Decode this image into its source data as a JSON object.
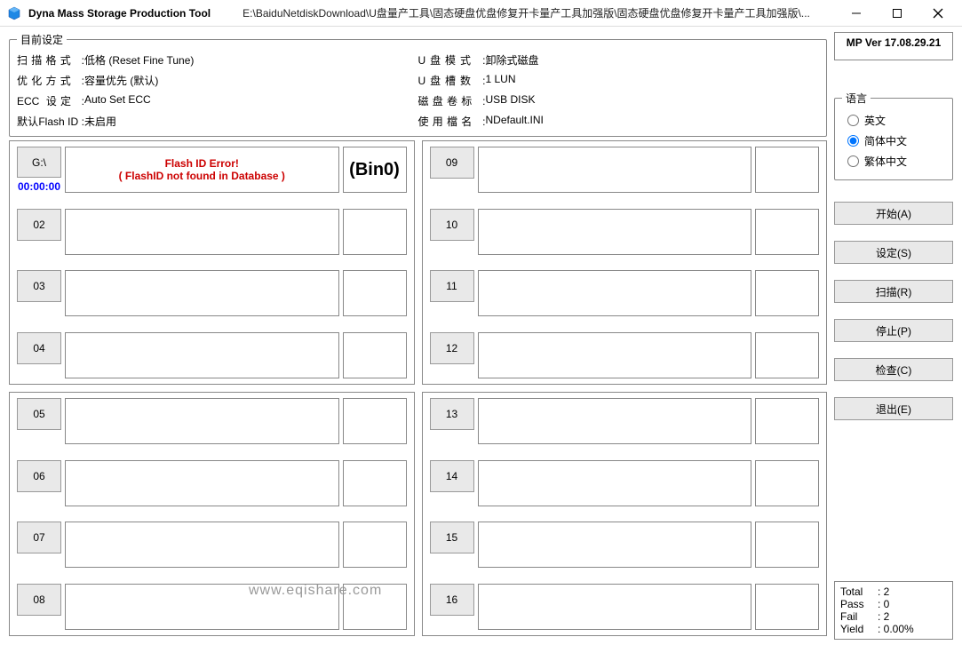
{
  "titlebar": {
    "app_title": "Dyna Mass Storage Production Tool",
    "path": "E:\\BaiduNetdiskDownload\\U盘量产工具\\固态硬盘优盘修复开卡量产工具加强版\\固态硬盘优盘修复开卡量产工具加强版\\..."
  },
  "settings": {
    "legend": "目前设定",
    "left": [
      {
        "label": "扫描格式",
        "value": "低格 (Reset Fine Tune)"
      },
      {
        "label": "优化方式",
        "value": "容量优先 (默认)"
      },
      {
        "label": "ECC 设定",
        "value": "Auto Set ECC"
      },
      {
        "label": "默认Flash ID",
        "value": "未启用"
      }
    ],
    "right": [
      {
        "label": "U盘模式",
        "value": "卸除式磁盘"
      },
      {
        "label": "U盘槽数",
        "value": "1 LUN"
      },
      {
        "label": "磁盘卷标",
        "value": "USB DISK"
      },
      {
        "label": "使用檔名",
        "value": "NDefault.INI"
      }
    ]
  },
  "slots": {
    "panels": [
      [
        {
          "id": "G:\\",
          "timer": "00:00:00",
          "status_line1": "Flash ID Error!",
          "status_line2": "( FlashID not found in Database )",
          "bin": "(Bin0)",
          "error": true
        },
        {
          "id": "02"
        },
        {
          "id": "03"
        },
        {
          "id": "04"
        }
      ],
      [
        {
          "id": "09"
        },
        {
          "id": "10"
        },
        {
          "id": "11"
        },
        {
          "id": "12"
        }
      ],
      [
        {
          "id": "05"
        },
        {
          "id": "06"
        },
        {
          "id": "07"
        },
        {
          "id": "08"
        }
      ],
      [
        {
          "id": "13"
        },
        {
          "id": "14"
        },
        {
          "id": "15"
        },
        {
          "id": "16"
        }
      ]
    ]
  },
  "version": "MP Ver 17.08.29.21",
  "language": {
    "legend": "语言",
    "options": [
      "英文",
      "简体中文",
      "繁体中文"
    ],
    "selected": "简体中文"
  },
  "actions": [
    "开始(A)",
    "设定(S)",
    "扫描(R)",
    "停止(P)",
    "检查(C)",
    "退出(E)"
  ],
  "stats": {
    "rows": [
      {
        "label": "Total",
        "value": "2"
      },
      {
        "label": "Pass",
        "value": "0"
      },
      {
        "label": "Fail",
        "value": "2"
      },
      {
        "label": "Yield",
        "value": "0.00%"
      }
    ]
  },
  "watermark": "www.eqishare.com"
}
